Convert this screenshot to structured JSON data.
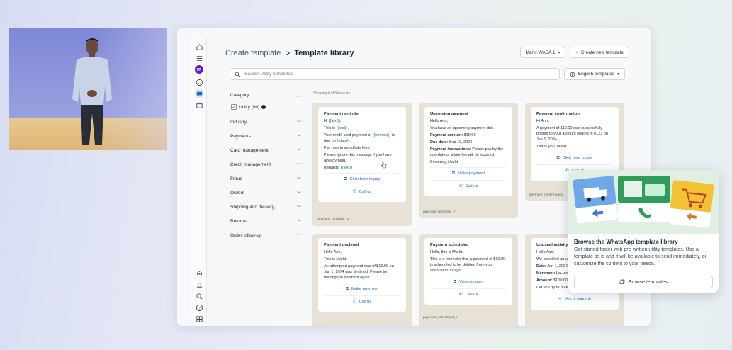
{
  "breadcrumb": {
    "parent": "Create template",
    "separator": ">",
    "current": "Template library"
  },
  "toolbar": {
    "account_label": "Markt WABA 1",
    "create_label": "Create new template",
    "language_label": "English templates"
  },
  "search": {
    "placeholder": "Search Utility templates"
  },
  "filters": {
    "category_label": "Category",
    "utility_label": "Utility (90)",
    "groups": [
      "Industry",
      "Payments",
      "Card management",
      "Credit management",
      "Fraud",
      "Orders",
      "Shipping and delivery",
      "Returns",
      "Order follow-up"
    ]
  },
  "results": {
    "showing": "Showing # of 54 results"
  },
  "cards": {
    "c1": {
      "title": "Payment reminder",
      "l1": "Hi",
      "v1": "{{text}}",
      "l1b": ",",
      "l2": "This is",
      "v2": "{{text}}",
      "l2b": ".",
      "l3": "Your credit card payment of",
      "v3": "{{number}}",
      "l3b": "is due on",
      "v3b": "{{date}}",
      "l3c": ".",
      "l4": "Pay now to avoid late fees.",
      "l5": "Please ignore this message if you have already paid.",
      "l6": "Regards,",
      "v6": "{{text}}",
      "a1": "Click here to pay",
      "a2": "Call us",
      "file": "payment_reminder_1"
    },
    "c2": {
      "title": "Upcoming payment",
      "l1": "Hello Ann,",
      "l2": "You have an upcoming payment due.",
      "k3": "Payment amount:",
      "v3": "$10.00",
      "k4": "Due date:",
      "v4": "Sep 10, 2024",
      "k5": "Payment instructions:",
      "v5": "Please pay by the due date or a late fee will be incurred.",
      "l6": "Sincerely, Markt",
      "a1": "Make payment",
      "a2": "Call us",
      "file": "payment_reminder_2"
    },
    "c3": {
      "title": "Payment confirmation",
      "l1": "Hi Ann,",
      "l2": "A payment of $10.00 was successfully posted to your account ending in 0123 on Jan 1, 2024.",
      "l3": "Thank you, Markt",
      "a1": "Click here to pay",
      "a2": "Call us",
      "file": "payment_confirmation"
    },
    "c4": {
      "title": "Payment declined",
      "l1": "Hello Ann,",
      "l2": "This is Markt.",
      "l3": "An attempted payment was of $10.00 on Jan 1, 2074 was declined. Please try making the payment again.",
      "a1": "Make payment",
      "a2": "Call us"
    },
    "c5": {
      "title": "Payment scheduled",
      "l1": "Hello, this is Markt.",
      "l2": "This is a reminder that a payment of $10.00 is scheduled to be debited from your account in 3 days.",
      "a1": "View account",
      "a2": "Call us",
      "file": "payment_scheduled_1"
    },
    "c6": {
      "title": "Unusual activity on...",
      "l1": "Hello Ann,",
      "l2": "We identified an u... your VISA card en...",
      "k3": "Date:",
      "v3": "Jan 1, 2024",
      "k4": "Merchant:",
      "v4": "LaLueu...",
      "k5": "Amount:",
      "v5": "$100.00",
      "l6": "Did you try to make this purchase?",
      "a1": "Yes, it was me"
    }
  },
  "popup": {
    "title": "Browse the WhatsApp template library",
    "description": "Get started faster with pre-written utility templates. Use a template as is and it will be available to send immediately, or customize the content to your needs.",
    "button": "Browse templates"
  },
  "colors": {
    "accent": "#1766d3",
    "variable": "#1f7a3a",
    "card_frame": "#e7e1d6",
    "meta_purple": "#5a1ecf"
  }
}
